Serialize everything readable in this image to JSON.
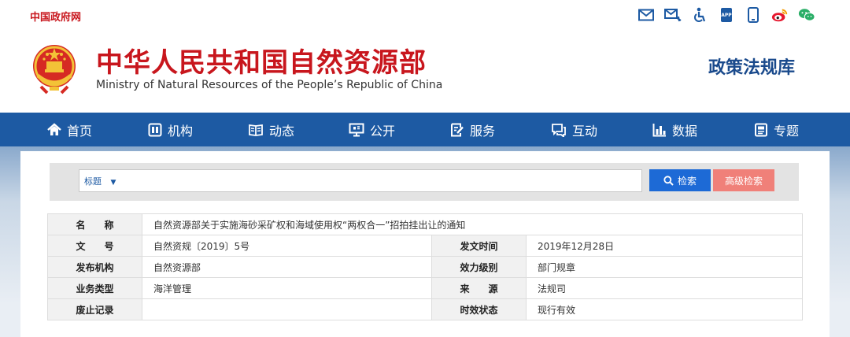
{
  "topbar": {
    "gov_link": "中国政府网",
    "icons": [
      "email-icon",
      "message-icon",
      "accessibility-icon",
      "app-icon",
      "mobile-icon",
      "weibo-icon",
      "wechat-icon"
    ]
  },
  "header": {
    "title_cn": "中华人民共和国自然资源部",
    "title_en": "Ministry of Natural Resources of the People’s Republic of China",
    "policy_library": "政策法规库"
  },
  "nav": {
    "items": [
      {
        "label": "首页",
        "icon": "home-icon"
      },
      {
        "label": "机构",
        "icon": "organization-icon"
      },
      {
        "label": "动态",
        "icon": "news-icon"
      },
      {
        "label": "公开",
        "icon": "disclosure-icon"
      },
      {
        "label": "服务",
        "icon": "service-icon"
      },
      {
        "label": "互动",
        "icon": "interaction-icon"
      },
      {
        "label": "数据",
        "icon": "data-chart-icon"
      },
      {
        "label": "专题",
        "icon": "topic-icon"
      }
    ]
  },
  "search": {
    "field_select": "标题",
    "query": "",
    "search_button": "检索",
    "advanced_button": "高级检索"
  },
  "record": {
    "name_key": "名　　称",
    "name_value": "自然资源部关于实施海砂采矿权和海域使用权“两权合一”招拍挂出让的通知",
    "doc_no_key": "文　　号",
    "doc_no_value": "自然资规〔2019〕5号",
    "issue_date_key": "发文时间",
    "issue_date_value": "2019年12月28日",
    "issuer_key": "发布机构",
    "issuer_value": "自然资源部",
    "level_key": "效力级别",
    "level_value": "部门规章",
    "category_key": "业务类型",
    "category_value": "海洋管理",
    "source_key": "来　　源",
    "source_value": "法规司",
    "repeal_key": "废止记录",
    "repeal_value": "",
    "status_key": "时效状态",
    "status_value": "现行有效"
  },
  "colors": {
    "brand_red": "#c8161d",
    "nav_blue": "#1d5aa3",
    "search_blue": "#1d6ad6",
    "advanced_pink": "#f08079"
  }
}
